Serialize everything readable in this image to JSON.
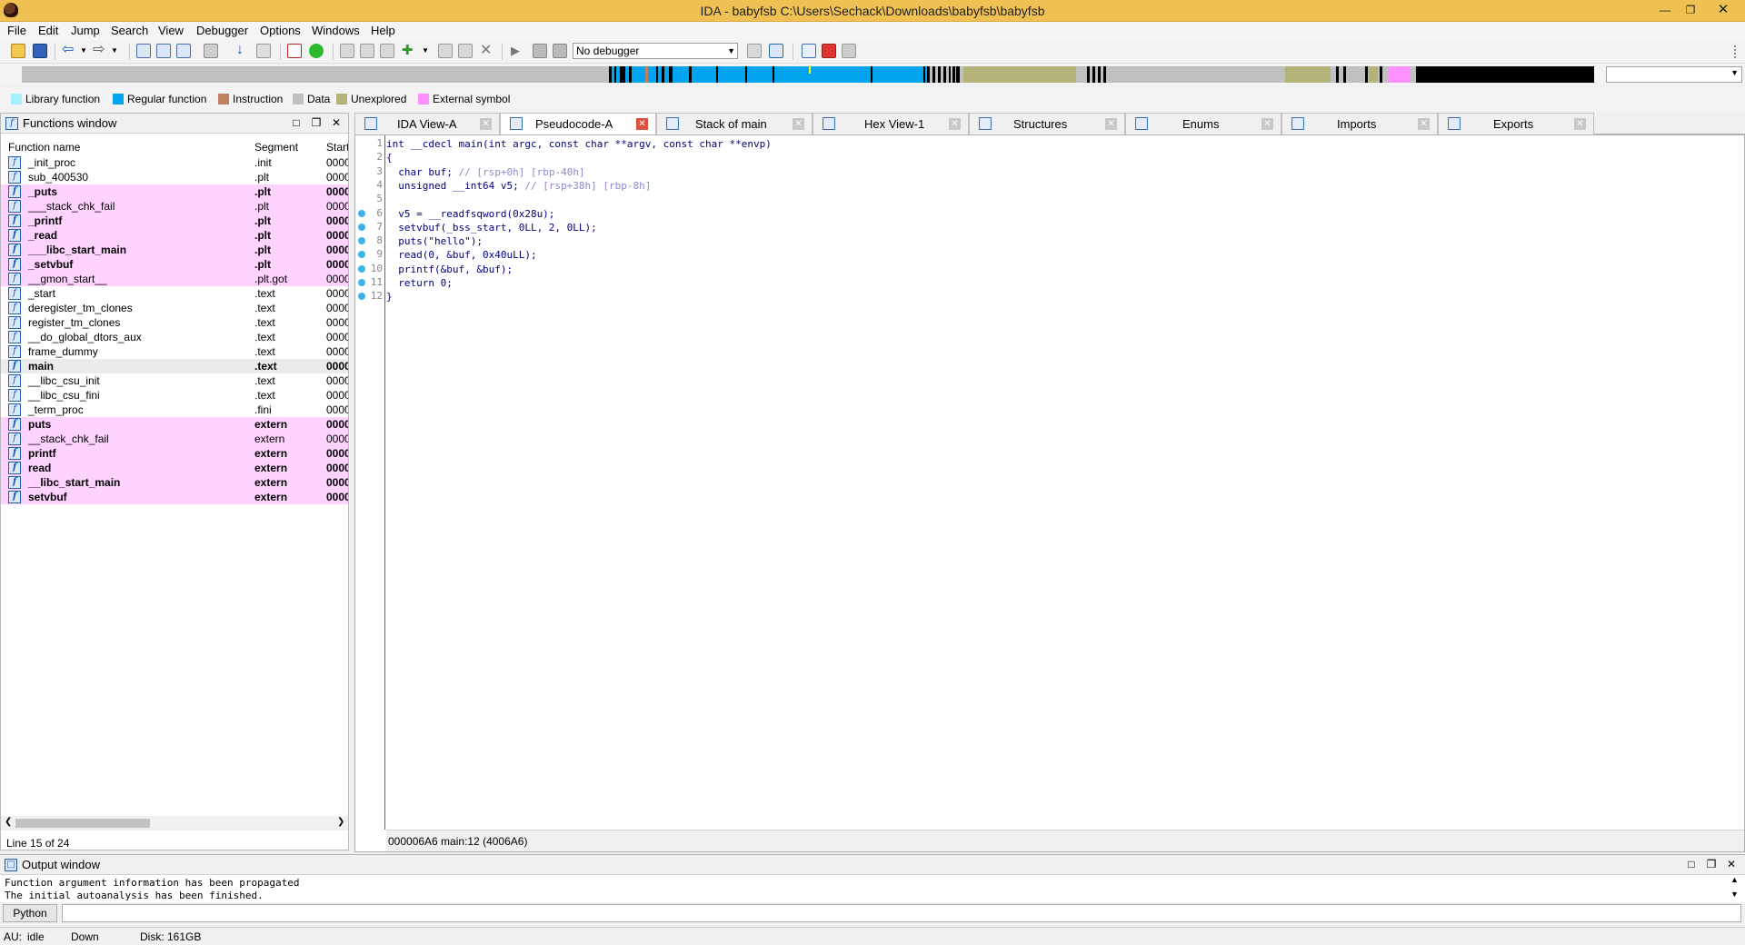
{
  "window": {
    "title": "IDA - babyfsb C:\\Users\\Sechack\\Downloads\\babyfsb\\babyfsb"
  },
  "menu": [
    "File",
    "Edit",
    "Jump",
    "Search",
    "View",
    "Debugger",
    "Options",
    "Windows",
    "Help"
  ],
  "toolbar": {
    "debugger_value": "No debugger"
  },
  "legend": [
    {
      "label": "Library function",
      "color": "#a8f0ff"
    },
    {
      "label": "Regular function",
      "color": "#00a4ef"
    },
    {
      "label": "Instruction",
      "color": "#c08060"
    },
    {
      "label": "Data",
      "color": "#c0c0c0"
    },
    {
      "label": "Unexplored",
      "color": "#b4b47a"
    },
    {
      "label": "External symbol",
      "color": "#ff90ff"
    }
  ],
  "functions_window": {
    "title": "Functions window",
    "columns": [
      "Function name",
      "Segment",
      "Start"
    ],
    "rows": [
      {
        "name": "_init_proc",
        "segment": ".init",
        "start": "0000",
        "bold": false,
        "extern": false
      },
      {
        "name": "sub_400530",
        "segment": ".plt",
        "start": "0000",
        "bold": false,
        "extern": false
      },
      {
        "name": "_puts",
        "segment": ".plt",
        "start": "0000",
        "bold": true,
        "extern": true
      },
      {
        "name": "___stack_chk_fail",
        "segment": ".plt",
        "start": "0000",
        "bold": false,
        "extern": true
      },
      {
        "name": "_printf",
        "segment": ".plt",
        "start": "0000",
        "bold": true,
        "extern": true
      },
      {
        "name": "_read",
        "segment": ".plt",
        "start": "0000",
        "bold": true,
        "extern": true
      },
      {
        "name": "___libc_start_main",
        "segment": ".plt",
        "start": "0000",
        "bold": true,
        "extern": true
      },
      {
        "name": "_setvbuf",
        "segment": ".plt",
        "start": "0000",
        "bold": true,
        "extern": true
      },
      {
        "name": "__gmon_start__",
        "segment": ".plt.got",
        "start": "0000",
        "bold": false,
        "extern": true
      },
      {
        "name": "_start",
        "segment": ".text",
        "start": "0000",
        "bold": false,
        "extern": false
      },
      {
        "name": "deregister_tm_clones",
        "segment": ".text",
        "start": "0000",
        "bold": false,
        "extern": false
      },
      {
        "name": "register_tm_clones",
        "segment": ".text",
        "start": "0000",
        "bold": false,
        "extern": false
      },
      {
        "name": "__do_global_dtors_aux",
        "segment": ".text",
        "start": "0000",
        "bold": false,
        "extern": false
      },
      {
        "name": "frame_dummy",
        "segment": ".text",
        "start": "0000",
        "bold": false,
        "extern": false
      },
      {
        "name": "main",
        "segment": ".text",
        "start": "0000",
        "bold": true,
        "extern": false,
        "selected": true
      },
      {
        "name": "__libc_csu_init",
        "segment": ".text",
        "start": "0000",
        "bold": false,
        "extern": false
      },
      {
        "name": "__libc_csu_fini",
        "segment": ".text",
        "start": "0000",
        "bold": false,
        "extern": false
      },
      {
        "name": "_term_proc",
        "segment": ".fini",
        "start": "0000",
        "bold": false,
        "extern": false
      },
      {
        "name": "puts",
        "segment": "extern",
        "start": "0000",
        "bold": true,
        "extern": true
      },
      {
        "name": "__stack_chk_fail",
        "segment": "extern",
        "start": "0000",
        "bold": false,
        "extern": true
      },
      {
        "name": "printf",
        "segment": "extern",
        "start": "0000",
        "bold": true,
        "extern": true
      },
      {
        "name": "read",
        "segment": "extern",
        "start": "0000",
        "bold": true,
        "extern": true
      },
      {
        "name": "__libc_start_main",
        "segment": "extern",
        "start": "0000",
        "bold": true,
        "extern": true
      },
      {
        "name": "setvbuf",
        "segment": "extern",
        "start": "0000",
        "bold": true,
        "extern": true
      }
    ],
    "status": "Line 15 of 24"
  },
  "tabs": [
    {
      "label": "IDA View-A",
      "active": false
    },
    {
      "label": "Pseudocode-A",
      "active": true
    },
    {
      "label": "Stack of main",
      "active": false
    },
    {
      "label": "Hex View-1",
      "active": false
    },
    {
      "label": "Structures",
      "active": false
    },
    {
      "label": "Enums",
      "active": false
    },
    {
      "label": "Imports",
      "active": false
    },
    {
      "label": "Exports",
      "active": false
    }
  ],
  "pseudocode": {
    "lines": [
      {
        "n": "1",
        "dot": false,
        "text": "int __cdecl main(int argc, const char **argv, const char **envp)"
      },
      {
        "n": "2",
        "dot": false,
        "text": "{"
      },
      {
        "n": "3",
        "dot": false,
        "text": "  char buf; // [rsp+0h] [rbp-40h]"
      },
      {
        "n": "4",
        "dot": false,
        "text": "  unsigned __int64 v5; // [rsp+38h] [rbp-8h]"
      },
      {
        "n": "5",
        "dot": false,
        "text": ""
      },
      {
        "n": "6",
        "dot": true,
        "text": "  v5 = __readfsqword(0x28u);"
      },
      {
        "n": "7",
        "dot": true,
        "text": "  setvbuf(_bss_start, 0LL, 2, 0LL);"
      },
      {
        "n": "8",
        "dot": true,
        "text": "  puts(\"hello\");"
      },
      {
        "n": "9",
        "dot": true,
        "text": "  read(0, &buf, 0x40uLL);"
      },
      {
        "n": "10",
        "dot": true,
        "text": "  printf(&buf, &buf);"
      },
      {
        "n": "11",
        "dot": true,
        "text": "  return 0;"
      },
      {
        "n": "12",
        "dot": true,
        "text": "}"
      }
    ],
    "status": "000006A6 main:12 (4006A6)"
  },
  "output_window": {
    "title": "Output window",
    "lines": [
      "Function argument information has been propagated",
      "The initial autoanalysis has been finished."
    ],
    "python_label": "Python"
  },
  "statusbar": {
    "au": "AU:",
    "au_state": "idle",
    "direction": "Down",
    "disk": "Disk: 161GB"
  }
}
